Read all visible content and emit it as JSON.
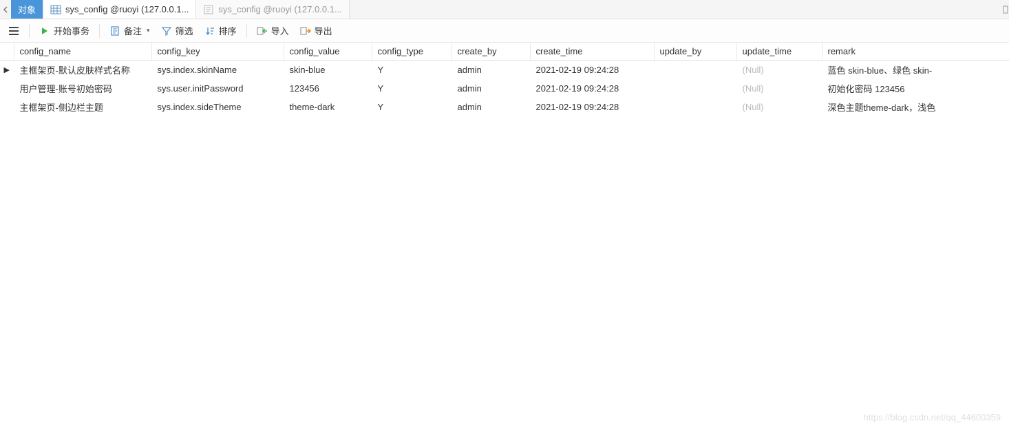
{
  "tabs": {
    "obj_label": "对象",
    "t1_label": "sys_config @ruoyi (127.0.0.1...",
    "t2_label": "sys_config @ruoyi (127.0.0.1..."
  },
  "toolbar": {
    "start_txn": "开始事务",
    "memo": "备注",
    "filter": "筛选",
    "sort": "排序",
    "import": "导入",
    "export": "导出"
  },
  "columns": {
    "config_name": "config_name",
    "config_key": "config_key",
    "config_value": "config_value",
    "config_type": "config_type",
    "create_by": "create_by",
    "create_time": "create_time",
    "update_by": "update_by",
    "update_time": "update_time",
    "remark": "remark"
  },
  "null_text": "(Null)",
  "row_pointer": "▶",
  "rows": [
    {
      "config_name": "主框架页-默认皮肤样式名称",
      "config_key": "sys.index.skinName",
      "config_value": "skin-blue",
      "config_type": "Y",
      "create_by": "admin",
      "create_time": "2021-02-19 09:24:28",
      "update_by": "",
      "update_time": null,
      "remark": "蓝色 skin-blue、绿色 skin-"
    },
    {
      "config_name": "用户管理-账号初始密码",
      "config_key": "sys.user.initPassword",
      "config_value": "123456",
      "config_type": "Y",
      "create_by": "admin",
      "create_time": "2021-02-19 09:24:28",
      "update_by": "",
      "update_time": null,
      "remark": "初始化密码 123456"
    },
    {
      "config_name": "主框架页-侧边栏主题",
      "config_key": "sys.index.sideTheme",
      "config_value": "theme-dark",
      "config_type": "Y",
      "create_by": "admin",
      "create_time": "2021-02-19 09:24:28",
      "update_by": "",
      "update_time": null,
      "remark": "深色主题theme-dark，浅色"
    }
  ],
  "watermark": "https://blog.csdn.net/qq_44600359"
}
